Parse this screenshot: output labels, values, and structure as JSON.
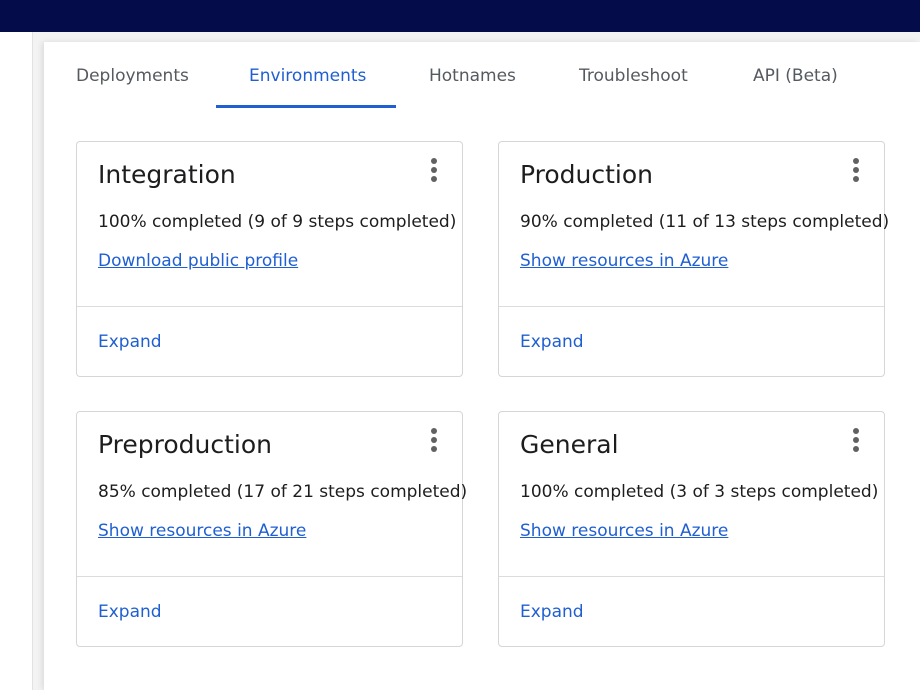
{
  "tabs": [
    {
      "label": "Deployments",
      "active": false
    },
    {
      "label": "Environments",
      "active": true
    },
    {
      "label": "Hotnames",
      "active": false
    },
    {
      "label": "Troubleshoot",
      "active": false
    },
    {
      "label": "API (Beta)",
      "active": false
    }
  ],
  "cards": [
    {
      "title": "Integration",
      "status": "100% completed (9 of 9 steps completed)",
      "link": "Download public profile",
      "expand": "Expand",
      "menu_icon": "kebab-vertical-icon"
    },
    {
      "title": "Production",
      "status": "90% completed (11 of 13 steps completed)",
      "link": "Show resources in Azure",
      "expand": "Expand",
      "menu_icon": "kebab-vertical-icon"
    },
    {
      "title": "Preproduction",
      "status": "85% completed (17 of 21 steps completed)",
      "link": "Show resources in Azure",
      "expand": "Expand",
      "menu_icon": "kebab-vertical-icon"
    },
    {
      "title": "General",
      "status": "100% completed (3 of 3 steps completed)",
      "link": "Show resources in Azure",
      "expand": "Expand",
      "menu_icon": "kebab-vertical-icon"
    }
  ],
  "colors": {
    "topbar": "#040c4a",
    "accent": "#1f5fd1",
    "text": "#1d1d1f",
    "tab_inactive": "#555a60"
  }
}
